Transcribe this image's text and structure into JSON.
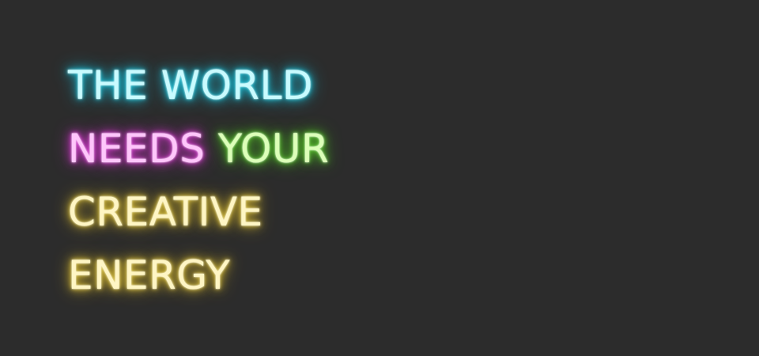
{
  "colors": {
    "background": "#2c2c2c",
    "cyan": "#22d8ef",
    "pink": "#f04cea",
    "green": "#6fe03a",
    "yellow": "#f2d84a"
  },
  "neon_sign": {
    "line1": "THE WORLD",
    "line2_part1": "NEEDS",
    "line2_part2": "YOUR",
    "line3": "CREATIVE",
    "line4": "ENERGY"
  }
}
